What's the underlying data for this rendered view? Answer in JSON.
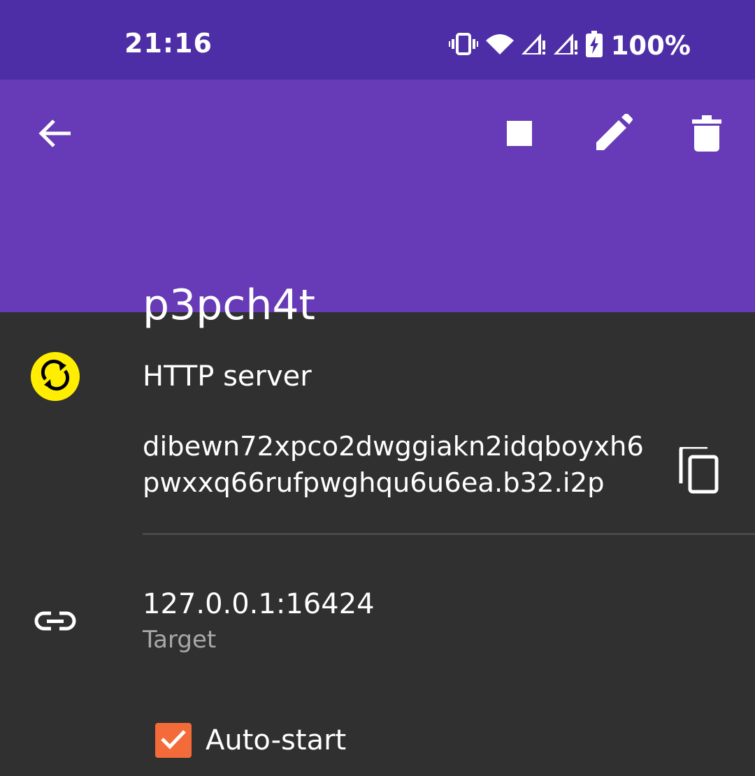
{
  "status_bar": {
    "time": "21:16",
    "battery_percent": "100%",
    "icons": [
      "vibrate-icon",
      "wifi-icon",
      "signal-no-internet-icon",
      "signal-no-internet-icon",
      "battery-charging-icon"
    ]
  },
  "app_bar": {
    "title": "p3pch4t",
    "actions": [
      "back-arrow-icon",
      "stop-icon",
      "edit-pencil-icon",
      "delete-trash-icon"
    ],
    "background_color": "#673ab7"
  },
  "tunnel": {
    "type_label": "HTTP server",
    "status_icon": "sync-icon",
    "status_color": "#ffee00",
    "address": "dibewn72xpco2dwggiakn2idqboyxh6pwxxq66rufpwghqu6u6ea.b32.i2p",
    "target_value": "127.0.0.1:16424",
    "target_label": "Target",
    "autostart_label": "Auto-start",
    "autostart_checked": true,
    "accent_color": "#f46b3a"
  }
}
